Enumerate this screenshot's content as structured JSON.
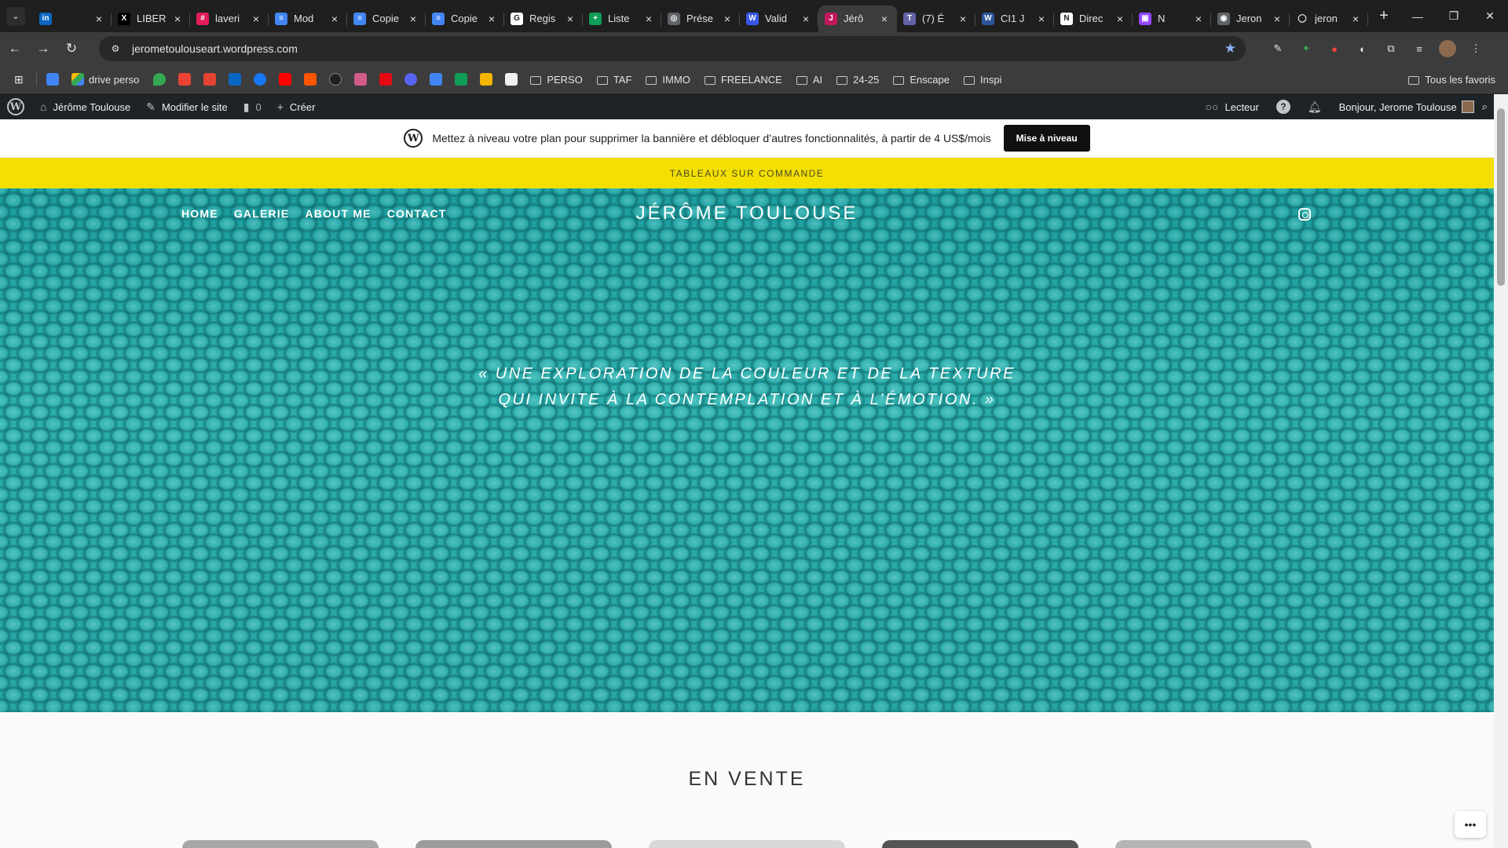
{
  "browser": {
    "tabs": [
      {
        "title": "",
        "icon": "linkedin-icon",
        "color": "#0a66c2",
        "glyph": "in"
      },
      {
        "title": "LIBER",
        "icon": "x-icon",
        "color": "#000000",
        "glyph": "X"
      },
      {
        "title": "laveri",
        "icon": "slack-icon",
        "color": "#e01e5a",
        "glyph": "#"
      },
      {
        "title": "Mod",
        "icon": "google-docs-icon",
        "color": "#4285f4",
        "glyph": "≡"
      },
      {
        "title": "Copie",
        "icon": "google-docs-icon",
        "color": "#4285f4",
        "glyph": "≡"
      },
      {
        "title": "Copie",
        "icon": "google-docs-icon",
        "color": "#4285f4",
        "glyph": "≡"
      },
      {
        "title": "Regis",
        "icon": "g-icon",
        "color": "#ffffff",
        "glyph": "G"
      },
      {
        "title": "Liste",
        "icon": "google-sheets-icon",
        "color": "#0f9d58",
        "glyph": "+"
      },
      {
        "title": "Prése",
        "icon": "generic-site-icon",
        "color": "#5f6368",
        "glyph": "◎"
      },
      {
        "title": "Valid",
        "icon": "wordpress-icon",
        "color": "#3858e9",
        "glyph": "W"
      },
      {
        "title": "Jérô",
        "icon": "site-favicon-icon",
        "color": "#c2185b",
        "glyph": "J"
      },
      {
        "title": "(7) É",
        "icon": "teams-icon",
        "color": "#6264a7",
        "glyph": "T"
      },
      {
        "title": "CI1 J",
        "icon": "word-icon",
        "color": "#2b579a",
        "glyph": "W"
      },
      {
        "title": "Direc",
        "icon": "notion-icon",
        "color": "#ffffff",
        "glyph": "N"
      },
      {
        "title": "N",
        "icon": "twitch-icon",
        "color": "#9146ff",
        "glyph": "▣"
      },
      {
        "title": "Jeron",
        "icon": "globe-icon",
        "color": "#5f6368",
        "glyph": "◉"
      },
      {
        "title": "jeron",
        "icon": "github-icon",
        "color": "#1f1f1f",
        "glyph": "◯"
      }
    ],
    "active_tab_index": 10,
    "url": "jerometoulouseart.wordpress.com",
    "bookmarks": {
      "drive_label": "drive perso",
      "folders": [
        "PERSO",
        "TAF",
        "IMMO",
        "FREELANCE",
        "AI",
        "24-25",
        "Enscape",
        "Inspi"
      ],
      "all_bookmarks_label": "Tous les favoris"
    }
  },
  "wp_admin_bar": {
    "site_name": "Jérôme Toulouse",
    "edit_site": "Modifier le site",
    "comments_count": "0",
    "create": "Créer",
    "reader": "Lecteur",
    "greeting": "Bonjour, Jerome Toulouse"
  },
  "upgrade_banner": {
    "text": "Mettez à niveau votre plan pour supprimer la bannière et débloquer d’autres fonctionnalités, à partir de 4 US$/mois",
    "button": "Mise à niveau"
  },
  "announcement": "TABLEAUX SUR COMMANDE",
  "site": {
    "nav": [
      "HOME",
      "GALERIE",
      "ABOUT ME",
      "CONTACT"
    ],
    "title": "JÉRÔME TOULOUSE",
    "quote_line1": "« UNE EXPLORATION DE LA COULEUR ET DE LA TEXTURE",
    "quote_line2": "QUI INVITE À LA CONTEMPLATION ET À L’ÉMOTION. »",
    "section_title": "EN VENTE"
  },
  "colors": {
    "accent_yellow": "#f3df02",
    "hero_teal": "#2aa5a5",
    "admin_bar": "#1d2327"
  }
}
